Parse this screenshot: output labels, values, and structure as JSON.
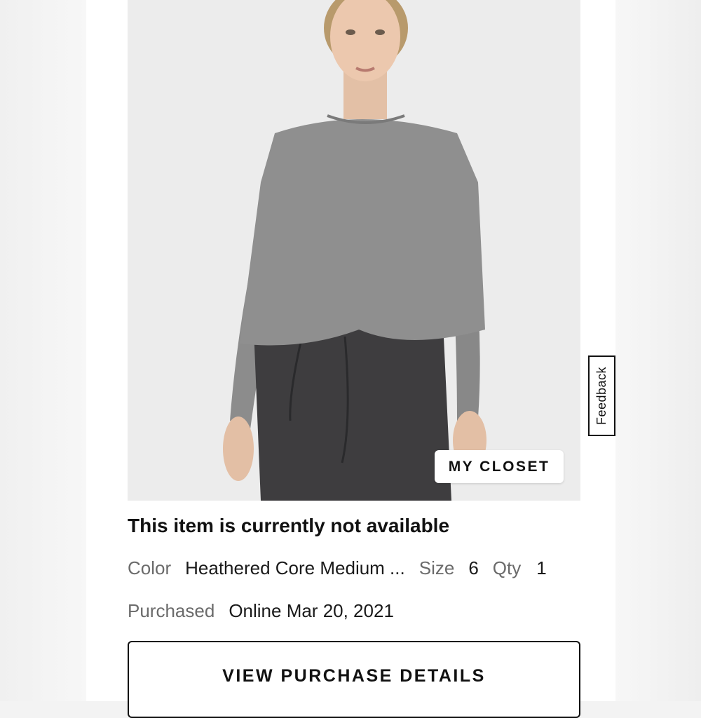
{
  "product": {
    "image_icon": "product-photo-model-gray-top",
    "my_closet_label": "MY CLOSET",
    "status": "This item is currently not available",
    "color_label": "Color",
    "color_value": "Heathered Core Medium ...",
    "size_label": "Size",
    "size_value": "6",
    "qty_label": "Qty",
    "qty_value": "1",
    "purchased_label": "Purchased",
    "purchased_value": "Online Mar 20, 2021",
    "view_button_label": "VIEW PURCHASE DETAILS"
  },
  "feedback": {
    "label": "Feedback"
  },
  "colors": {
    "top": "#8e8e8e",
    "pants": "#3e3d3f",
    "background": "#ededed"
  }
}
